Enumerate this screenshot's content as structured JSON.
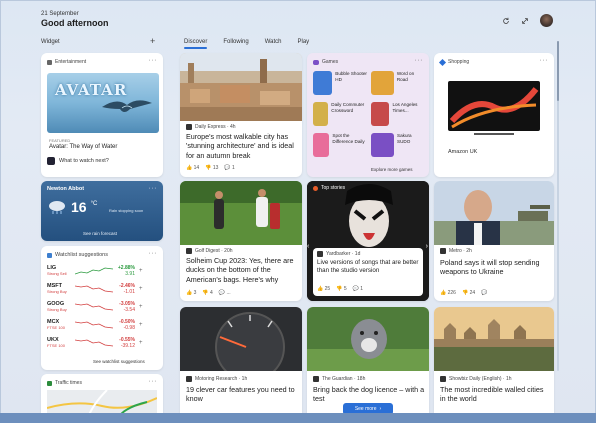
{
  "header": {
    "date": "21 September",
    "greeting": "Good afternoon",
    "refresh_icon": "refresh-icon",
    "expand_icon": "expand-icon"
  },
  "widgets_label": "Widget",
  "add_icon": "+",
  "tabs": [
    {
      "label": "Discover",
      "active": true
    },
    {
      "label": "Following",
      "active": false
    },
    {
      "label": "Watch",
      "active": false
    },
    {
      "label": "Play",
      "active": false
    }
  ],
  "entertainment": {
    "header": "Entertainment",
    "logo": "AVATAR",
    "featured": "FEATURED",
    "movie": "Avatar: The Way of Water",
    "link": "What to watch next?"
  },
  "weather": {
    "location": "Newton Abbot",
    "temp": "16",
    "unit": "°C",
    "note": "Rain stopping soon",
    "link": "See rain forecast"
  },
  "watchlist": {
    "header": "Watchlist suggestions",
    "rows": [
      {
        "sym": "LIG",
        "sub": "Strong Sell",
        "chg": "+2.88%",
        "chg2": "3.91",
        "up": true
      },
      {
        "sym": "MSFT",
        "sub": "Strong Buy",
        "chg": "-2.46%",
        "chg2": "-1.01",
        "up": false
      },
      {
        "sym": "GOOG",
        "sub": "Strong Buy",
        "chg": "-3.05%",
        "chg2": "-3.54",
        "up": false
      },
      {
        "sym": "MCX",
        "sub": "FTSE 100",
        "chg": "-0.50%",
        "chg2": "-0.98",
        "up": false
      },
      {
        "sym": "UKX",
        "sub": "FTSE 100",
        "chg": "-0.55%",
        "chg2": "-39.12",
        "up": false
      }
    ],
    "link": "See watchlist suggestions"
  },
  "traffic": {
    "header": "Traffic times"
  },
  "story_europe": {
    "source": "Daily Express · 4h",
    "title": "Europe's most walkable city has 'stunning architecture' and is ideal for an autumn break",
    "likes": "14",
    "dislikes": "13",
    "comments": "1"
  },
  "games": {
    "header": "Games",
    "items": [
      {
        "name": "Bubble Shooter HD"
      },
      {
        "name": "Word on Road"
      },
      {
        "name": "Daily Commuter Crossword"
      },
      {
        "name": "Los Angeles Times..."
      },
      {
        "name": "Spot the Difference Daily"
      },
      {
        "name": "Sakura SUDO"
      }
    ],
    "link": "Explore more games"
  },
  "shopping": {
    "header": "Shopping",
    "store": "Amazon UK"
  },
  "story_golf": {
    "source": "Golf Digest · 20h",
    "title": "Solheim Cup 2023: Yes, there are ducks on the bottom of the American's bags. Here's why",
    "likes": "3",
    "dislikes": "4",
    "comments": "..."
  },
  "story_kiss": {
    "badge": "Top stories",
    "source": "Yardbarker · 1d",
    "title": "Live versions of songs that are better than the studio version",
    "likes": "25",
    "dislikes": "5",
    "comments": "1"
  },
  "story_poland": {
    "source": "Metro · 2h",
    "title": "Poland says it will stop sending weapons to Ukraine",
    "likes": "226",
    "dislikes": "24",
    "comments": ""
  },
  "story_car": {
    "source": "Motoring Research · 1h",
    "title": "19 clever car features you need to know"
  },
  "story_dog": {
    "source": "The Guardian · 18h",
    "title": "Bring back the dog licence – with a test",
    "see_more": "See more"
  },
  "story_walled": {
    "source": "Showbiz Daily (English) · 1h",
    "title": "The most incredible walled cities in the world"
  }
}
